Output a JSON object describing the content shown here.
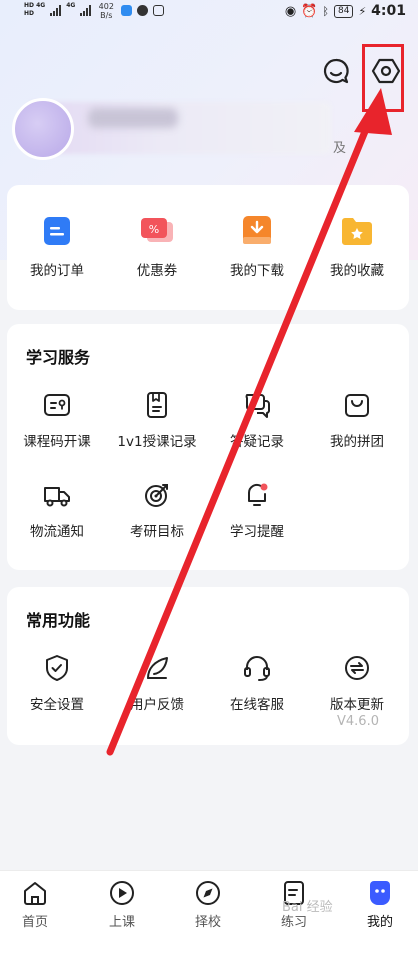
{
  "status_bar": {
    "net1": "HD 4G",
    "net2": "4G",
    "speed": "402 B/s",
    "battery": "84",
    "time": "4:01"
  },
  "header": {
    "message_icon": "message-smile-icon",
    "settings_icon": "settings-hexagon-icon"
  },
  "profile": {
    "suffix": "及"
  },
  "orders": [
    {
      "label": "我的订单",
      "icon": "order-icon",
      "color": "#2f7bf6"
    },
    {
      "label": "优惠券",
      "icon": "coupon-icon",
      "color": "#f2545b"
    },
    {
      "label": "我的下载",
      "icon": "download-icon",
      "color": "#f5862b"
    },
    {
      "label": "我的收藏",
      "icon": "favorite-folder-icon",
      "color": "#f8b632"
    }
  ],
  "services": {
    "title": "学习服务",
    "items": [
      {
        "label": "课程码开课",
        "icon": "course-code-icon"
      },
      {
        "label": "1v1授课记录",
        "icon": "lesson-record-icon"
      },
      {
        "label": "答疑记录",
        "icon": "qa-record-icon"
      },
      {
        "label": "我的拼团",
        "icon": "group-buy-bag-icon"
      },
      {
        "label": "物流通知",
        "icon": "delivery-truck-icon"
      },
      {
        "label": "考研目标",
        "icon": "target-icon"
      },
      {
        "label": "学习提醒",
        "icon": "reminder-bell-icon"
      }
    ]
  },
  "functions": {
    "title": "常用功能",
    "items": [
      {
        "label": "安全设置",
        "icon": "security-shield-icon"
      },
      {
        "label": "用户反馈",
        "icon": "feedback-pen-icon"
      },
      {
        "label": "在线客服",
        "icon": "customer-service-headset-icon"
      },
      {
        "label": "版本更新",
        "icon": "version-update-icon"
      }
    ],
    "version": "V4.6.0"
  },
  "bottom_nav": [
    {
      "label": "首页",
      "icon": "home-icon"
    },
    {
      "label": "上课",
      "icon": "play-class-icon"
    },
    {
      "label": "择校",
      "icon": "compass-icon"
    },
    {
      "label": "练习",
      "icon": "practice-doc-icon"
    },
    {
      "label": "我的",
      "icon": "profile-face-icon",
      "active": true
    }
  ],
  "watermark": "Bai 经验",
  "colors": {
    "accent_red": "#e8242c",
    "active_nav": "#3b5bff"
  }
}
